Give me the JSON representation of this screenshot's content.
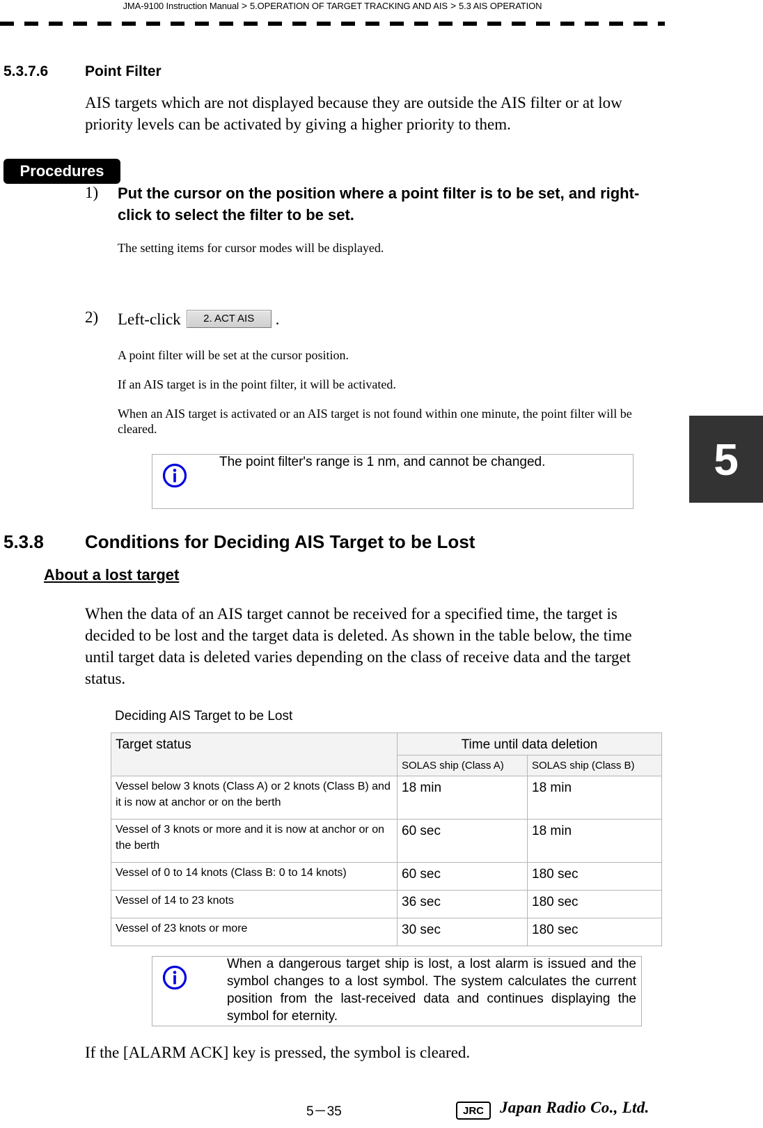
{
  "header": {
    "breadcrumb": [
      "JMA-9100 Instruction Manual",
      "5.OPERATION OF TARGET TRACKING AND AIS",
      "5.3  AIS OPERATION"
    ],
    "separator": ">"
  },
  "chapter_tab": "5",
  "section_1": {
    "number": "5.3.7.6",
    "title": "Point Filter",
    "intro": "AIS targets which are not displayed because they are outside the AIS filter or at low priority levels can be activated by giving a higher priority to them.",
    "procedures_label": "Procedures",
    "steps": [
      {
        "num": "1)",
        "text": "Put the cursor on the position where a point filter is to be set, and right-click to select the filter to be set.",
        "notes": [
          "The setting items for cursor modes will be displayed."
        ]
      },
      {
        "num": "2)",
        "text_before": "Left-click",
        "button_label": "2. ACT AIS",
        "text_after": ".",
        "notes": [
          "A point filter will be set at the cursor position.",
          "If an AIS target is in the point filter, it will be activated.",
          "When an AIS target is activated or an AIS target is not found within one minute, the point filter will be cleared."
        ]
      }
    ],
    "info_note": "The point filter's range is 1 nm, and cannot be changed."
  },
  "section_2": {
    "number": "5.3.8",
    "title": "Conditions for Deciding AIS Target to be Lost",
    "subheading": "About a lost target",
    "intro": "When the data of an AIS target cannot be received for a specified time, the target is decided to be lost and the target data is deleted. As shown in the table below, the time until target data is deleted varies depending on the class of receive data and the target status.",
    "table": {
      "caption": "Deciding AIS Target to be Lost",
      "header_status": "Target status",
      "header_group": "Time until data deletion",
      "header_class_a": "SOLAS ship (Class A)",
      "header_class_b": "SOLAS ship (Class B)",
      "rows": [
        {
          "status": "Vessel below 3 knots (Class A) or 2 knots (Class B) and it is now at anchor or on the berth",
          "class_a": "18 min",
          "class_b": "18 min"
        },
        {
          "status": "Vessel of 3 knots or more and it is now at anchor or on the berth",
          "class_a": "60 sec",
          "class_b": "18 min"
        },
        {
          "status": "Vessel of 0 to 14 knots (Class B: 0 to 14 knots)",
          "class_a": "60 sec",
          "class_b": "180 sec"
        },
        {
          "status": "Vessel of 14 to 23 knots",
          "class_a": "36 sec",
          "class_b": "180 sec"
        },
        {
          "status": "Vessel of 23 knots or more",
          "class_a": "30 sec",
          "class_b": "180 sec"
        }
      ]
    },
    "info_note": "When a dangerous target ship is lost, a lost alarm is issued and the symbol changes to a lost symbol. The system calculates the current position from the last-received data and continues displaying the symbol for eternity.",
    "closing": "If the [ALARM ACK] key is pressed, the symbol is cleared."
  },
  "footer": {
    "page_number": "5－35",
    "logo_mark": "JRC",
    "company": "Japan Radio Co., Ltd."
  },
  "colors": {
    "chapter_tab_bg": "#333333",
    "info_icon": "#0000e0",
    "table_header_bg": "#f3f3f3",
    "border": "#b5b5b5"
  }
}
